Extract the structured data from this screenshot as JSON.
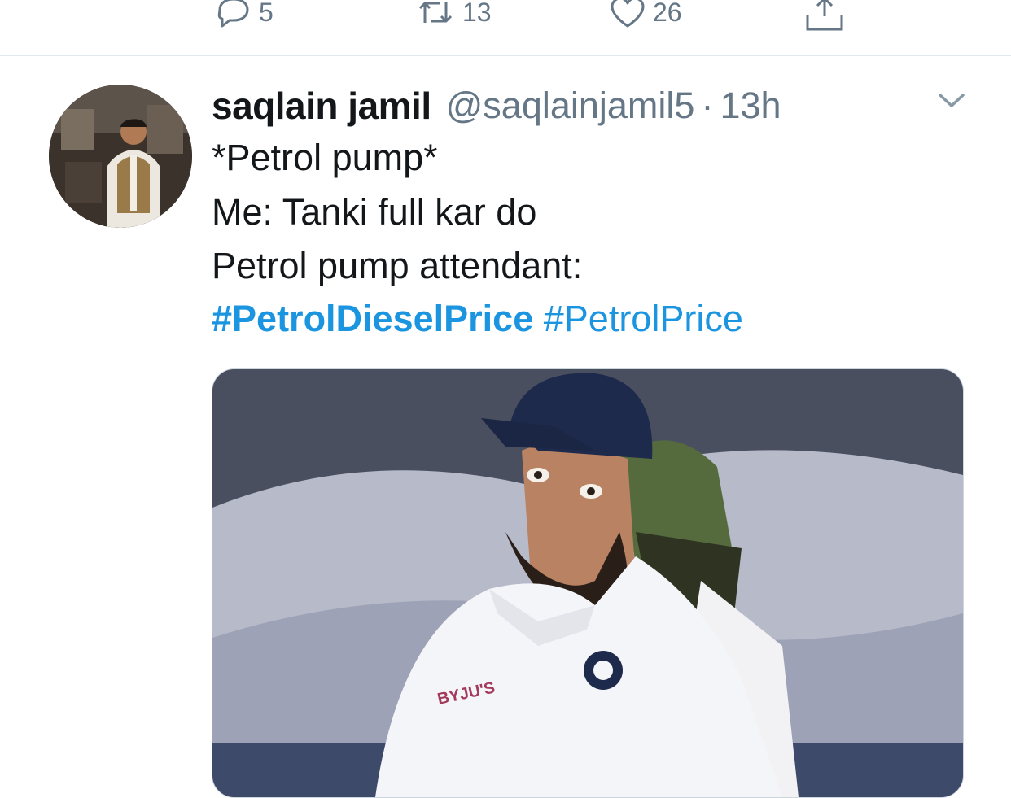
{
  "actions": {
    "reply_count": "5",
    "retweet_count": "13",
    "like_count": "26"
  },
  "tweet": {
    "display_name": "saqlain jamil",
    "handle": "@saqlainjamil5",
    "separator": "·",
    "time": "13h",
    "lines": [
      "*Petrol pump*",
      "Me: Tanki full kar do",
      "Petrol pump attendant:"
    ],
    "hashtags": [
      "#PetrolDieselPrice",
      "#PetrolPrice"
    ]
  },
  "media": {
    "cap_logo": "BYJU'S"
  },
  "colors": {
    "link": "#1b95e0",
    "secondary": "#657786",
    "primary": "#14171a",
    "divider": "#e1e8ed"
  }
}
